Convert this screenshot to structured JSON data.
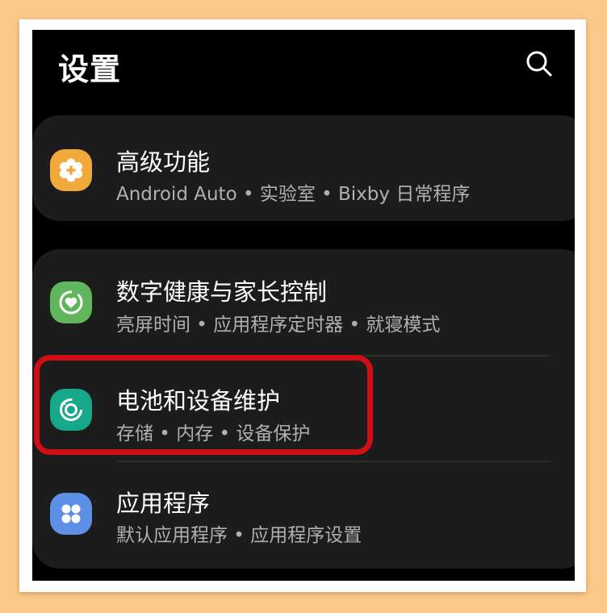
{
  "page": {
    "title": "设置"
  },
  "header": {
    "search_icon": "search-icon"
  },
  "cards": [
    {
      "items": [
        {
          "title": "高级功能",
          "subtitle": "Android Auto • 实验室 • Bixby 日常程序",
          "icon": "gear-plus-icon",
          "icon_color": "#f0a93a"
        }
      ]
    },
    {
      "items": [
        {
          "title": "数字健康与家长控制",
          "subtitle": "亮屏时间 • 应用程序定时器 • 就寝模式",
          "icon": "wellbeing-heart-icon",
          "icon_color": "#5fb65c"
        },
        {
          "title": "电池和设备维护",
          "subtitle": "存储 • 内存 • 设备保护",
          "icon": "device-care-icon",
          "icon_color": "#16a889",
          "highlighted": true,
          "highlight_color": "#d00e16"
        },
        {
          "title": "应用程序",
          "subtitle": "默认应用程序 • 应用程序设置",
          "icon": "apps-grid-icon",
          "icon_color": "#5d8fe6"
        }
      ]
    }
  ]
}
